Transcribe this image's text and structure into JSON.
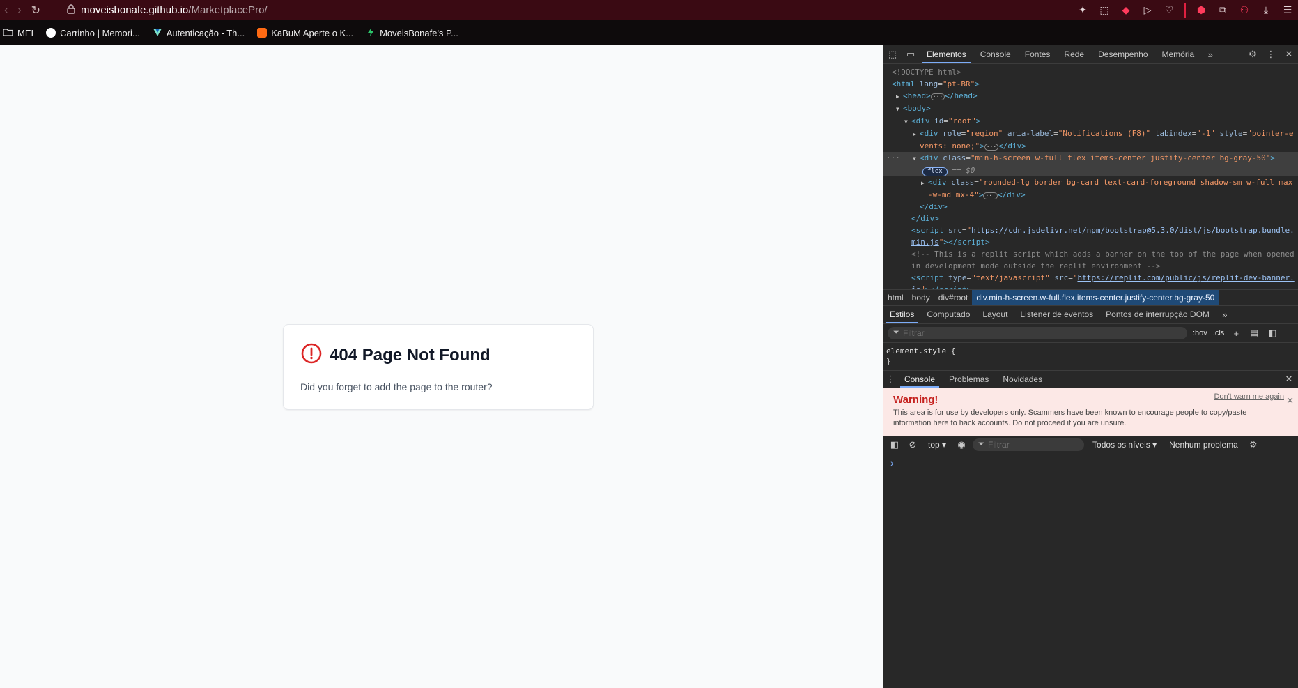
{
  "browser": {
    "url_host": "moveisbonafe.github.io",
    "url_path": "/MarketplacePro/",
    "bookmarks": [
      {
        "label": "MEI",
        "icon": "folder-icon",
        "color": "#cccccc"
      },
      {
        "label": "Carrinho | Memori...",
        "icon": "cart-favicon",
        "color": "#ffffff"
      },
      {
        "label": "Autenticação - Th...",
        "icon": "vuetify-favicon",
        "color": "#7de3c8"
      },
      {
        "label": "KaBuM Aperte o K...",
        "icon": "kabum-favicon",
        "color": "#ff6a13"
      },
      {
        "label": "MoveisBonafe's P...",
        "icon": "replit-favicon",
        "color": "#2cc66b"
      }
    ]
  },
  "page": {
    "title": "404 Page Not Found",
    "description": "Did you forget to add the page to the router?",
    "accent": "#dc2626"
  },
  "devtools": {
    "tabs": [
      "Elementos",
      "Console",
      "Fontes",
      "Rede",
      "Desempenho",
      "Memória"
    ],
    "dom": {
      "doctype": "<!DOCTYPE html>",
      "html_open": "html",
      "html_attr": "lang",
      "html_val": "\"pt-BR\"",
      "head": "head",
      "body": "body",
      "root_attr": "id",
      "root_val": "\"root\"",
      "region_role": "\"region\"",
      "region_label": "\"Notifications (F8)\"",
      "region_tabindex": "\"-1\"",
      "region_style_a": "\"pointer-e",
      "region_style_b": "vents: none;\"",
      "sel_class": "\"min-h-screen w-full flex items-center justify-center bg-gray-50\"",
      "flex_badge": "flex",
      "eq0": "== $0",
      "card_class_a": "\"rounded-lg border bg-card text-card-foreground shadow-sm w-full max",
      "card_class_b": "-w-md mx-4\"",
      "script_src_a": "https://cdn.jsdelivr.net/npm/bootstrap@5.3.0/dist/js/bootstrap.bundle.",
      "script_src_b": "min.js",
      "comment_a": "<!-- This is a replit script which adds a banner on the top of the page when opened",
      "comment_b": "in development mode outside the replit environment -->",
      "script2_type": "\"text/javascript\"",
      "script2_src_a": "https://replit.com/public/js/replit-dev-banner.",
      "script2_src_b": "js"
    },
    "breadcrumbs": [
      "html",
      "body",
      "div#root",
      "div.min-h-screen.w-full.flex.items-center.justify-center.bg-gray-50"
    ],
    "style_tabs": [
      "Estilos",
      "Computado",
      "Layout",
      "Listener de eventos",
      "Pontos de interrupção DOM"
    ],
    "styles_filter_placeholder": "Filtrar",
    "hov": ":hov",
    "cls": ".cls",
    "element_style": "element.style {",
    "element_style_close": "}",
    "drawer_tabs": [
      "Console",
      "Problemas",
      "Novidades"
    ],
    "warning": {
      "title": "Warning!",
      "body": "This area is for use by developers only. Scammers have been known to encourage people to copy/paste information here to hack accounts. Do not proceed if you are unsure.",
      "dont_warn": "Don't warn me again"
    },
    "console": {
      "context": "top ▾",
      "filter_placeholder": "Filtrar",
      "levels": "Todos os níveis ▾",
      "issues": "Nenhum problema"
    }
  }
}
